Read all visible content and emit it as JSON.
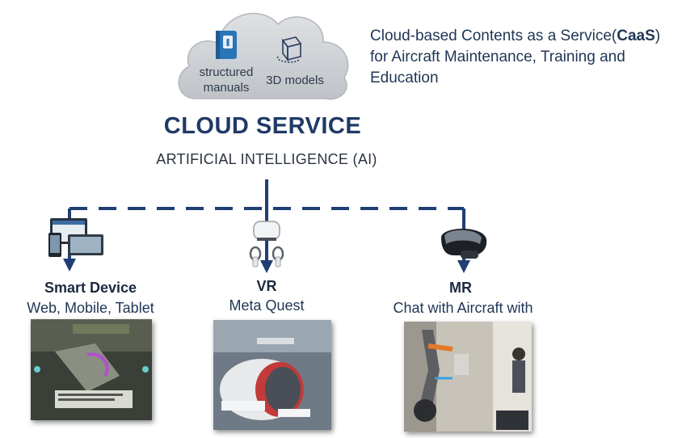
{
  "cloud": {
    "left_label": "structured\nmanuals",
    "right_label": "3D models"
  },
  "caas": {
    "line1_pre": "Cloud-based Contents as a Service(",
    "line1_bold": "CaaS",
    "line1_post": ")",
    "line2": "for Aircraft Maintenance, Training and",
    "line3": "Education"
  },
  "heading": {
    "title": "CLOUD SERVICE",
    "subtitle": "ARTIFICIAL INTELLIGENCE (AI)"
  },
  "devices": [
    {
      "title": "Smart Device",
      "subtitle": "Web, Mobile, Tablet"
    },
    {
      "title": "VR",
      "subtitle": "Meta Quest"
    },
    {
      "title": "MR",
      "subtitle": "Chat with Aircraft with"
    }
  ],
  "colors": {
    "connector": "#1f3f73",
    "title": "#1f3a66",
    "cloud": "#c9ccd1"
  },
  "icons": [
    "cloud-icon",
    "manual-book-icon",
    "3d-cube-icon",
    "devices-icon",
    "vr-headset-icon",
    "mr-headset-icon"
  ]
}
